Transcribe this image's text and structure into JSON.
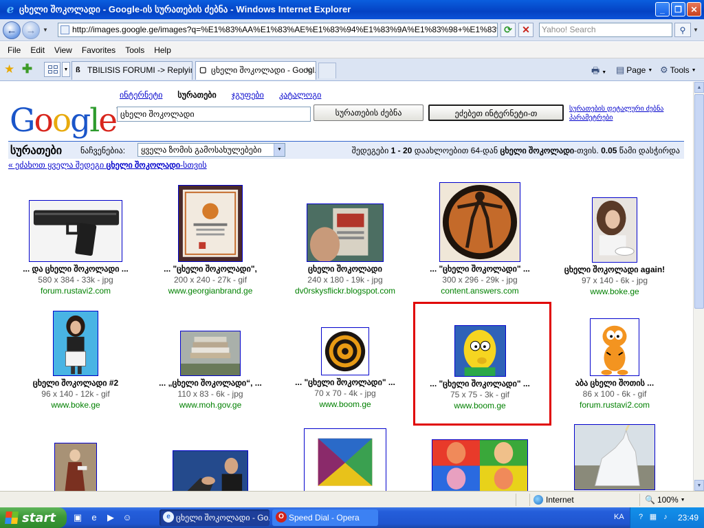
{
  "window": {
    "title": "ცხელი შოკოლადი - Google-ის სურათების ძებნა - Windows Internet Explorer",
    "url": "http://images.google.ge/images?q=%E1%83%AA%E1%83%AE%E1%83%94%E1%83%9A%E1%83%98+%E1%83%A6",
    "search_placeholder": "Yahoo! Search"
  },
  "menu": [
    "File",
    "Edit",
    "View",
    "Favorites",
    "Tools",
    "Help"
  ],
  "tabs": [
    {
      "label": "TBILISIS FORUMI -> Replyin..."
    },
    {
      "label": "ცხელი შოკოლადი - Googl..."
    }
  ],
  "commands": {
    "page": "Page",
    "tools": "Tools"
  },
  "google": {
    "logo": {
      "l1": "G",
      "l2": "o",
      "l3": "o",
      "l4": "g",
      "l5": "l",
      "l6": "e",
      "tm": "TM"
    },
    "nav": [
      "ინტერნეტი",
      "სურათები",
      "ჯგუფები",
      "კატალოგი"
    ],
    "query": "ცხელი შოკოლადი",
    "search_images_btn": "სურათების ძებნა",
    "search_web_btn": "ეძებეთ ინტერნეტი-თ",
    "advanced": "სურათების დეტალური ძებნა პარამეტრები",
    "results_label": "სურათები",
    "show_label": "ნაჩვენებია:",
    "size_select": "ყველა ზომის გამოსახულებები",
    "stats": {
      "prefix": "შედეგები",
      "range": "1 - 20",
      "middle": "დაახლოებით 64-დან",
      "term": "ცხელი შოკოლადი",
      "suffix": "-თვის.",
      "time": "0.05",
      "time_suffix": "წამი დასჭირდა"
    },
    "back_link": {
      "prefix": "« ეძახოთ ყველა შედეგი",
      "term": "ცხელი შოკოლადი",
      "suffix": "-სთვის"
    }
  },
  "results": [
    {
      "caption": "... და ცხელი შოკოლადი ...",
      "meta": "580 x 384 - 33k - jpg",
      "site": "forum.rustavi2.com"
    },
    {
      "caption": "... \"ცხელი შოკოლადი\",",
      "meta": "200 x 240 - 27k - gif",
      "site": "www.georgianbrand.ge"
    },
    {
      "caption": "ცხელი შოკოლადი",
      "meta": "240 x 180 - 19k - jpg",
      "site": "dv0rskysflickr.blogspot.com"
    },
    {
      "caption": "... \"ცხელი შოკოლადი\" ...",
      "meta": "300 x 296 - 29k - jpg",
      "site": "content.answers.com"
    },
    {
      "caption": "ცხელი შოკოლადი again!",
      "meta": "97 x 140 - 6k - jpg",
      "site": "www.boke.ge"
    },
    {
      "caption": "ცხელი შოკოლადი #2",
      "meta": "96 x 140 - 12k - gif",
      "site": "www.boke.ge"
    },
    {
      "caption": "... „ცხელი შოკოლადი“, ...",
      "meta": "110 x 83 - 6k - jpg",
      "site": "www.moh.gov.ge"
    },
    {
      "caption": "... \"ცხელი შოკოლადი\" ...",
      "meta": "70 x 70 - 4k - jpg",
      "site": "www.boom.ge"
    },
    {
      "caption": "... \"ცხელი შოკოლადი\" ...",
      "meta": "75 x 75 - 3k - gif",
      "site": "www.boom.ge"
    },
    {
      "caption": "აბა ცხელი შოთის ...",
      "meta": "86 x 100 - 6k - gif",
      "site": "forum.rustavi2.com"
    }
  ],
  "status": {
    "zone": "Internet",
    "zoom": "100%"
  },
  "taskbar": {
    "start": "start",
    "tasks": [
      {
        "label": "ცხელი შოკოლადი - Go..."
      },
      {
        "label": "Speed Dial - Opera"
      }
    ],
    "lang": "KA",
    "clock": "23:49"
  }
}
